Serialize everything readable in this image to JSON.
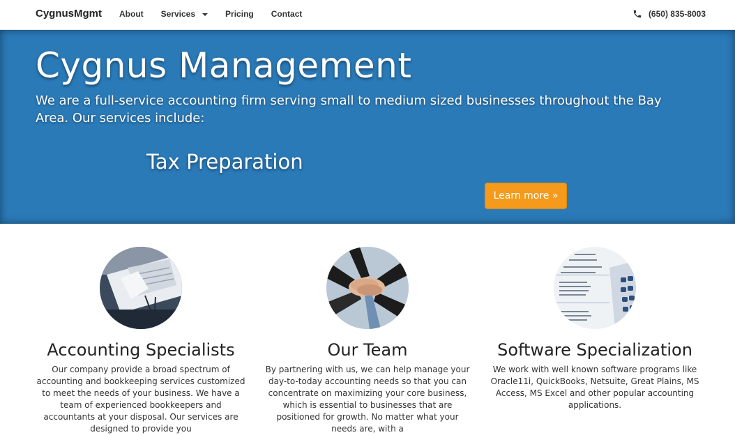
{
  "navbar": {
    "brand": "CygnusMgmt",
    "links": [
      {
        "label": "About"
      },
      {
        "label": "Services"
      },
      {
        "label": "Pricing"
      },
      {
        "label": "Contact"
      }
    ],
    "phone": "(650) 835-8003",
    "phone_icon": "phone-icon"
  },
  "hero": {
    "title": "Cygnus Management",
    "description": "We are a full-service accounting firm serving small to medium sized businesses throughout the Bay Area. Our services include:",
    "service": "Tax Preparation",
    "button": "Learn more »",
    "background_color": "#2a7ab8",
    "button_color": "#f59a1b"
  },
  "features": [
    {
      "title": "Accounting Specialists",
      "text": "Our company provide a broad spectrum of accounting and bookkeeping services customized to meet the needs of your business. We have a team of experienced bookkeepers and accountants at your disposal. Our services are designed to provide you",
      "image": "desk-documents-pen-photo"
    },
    {
      "title": "Our Team",
      "text": "By partnering with us, we can help manage your day-to-today accounting needs so that you can concentrate on maximizing your core business, which is essential to businesses that are positioned for growth. No matter what your needs are, with a",
      "image": "team-hands-stacked-photo"
    },
    {
      "title": "Software Specialization",
      "text": "We work with well known software programs like Oracle11i, QuickBooks, Netsuite, Great Plains, MS Access, MS Excel and other popular accounting applications.",
      "image": "calculator-tax-form-photo"
    }
  ]
}
